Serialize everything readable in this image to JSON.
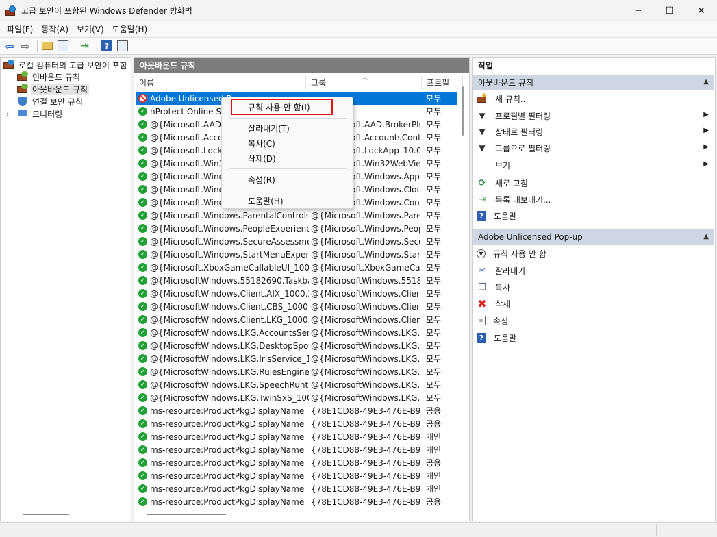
{
  "window": {
    "title": "고급 보안이 포함된 Windows Defender 방화벽",
    "minimize": "─",
    "maximize": "☐",
    "close": "✕"
  },
  "menubar": [
    "파일(F)",
    "동작(A)",
    "보기(V)",
    "도움말(H)"
  ],
  "toolbar": {
    "back_icon": "back-arrow-icon",
    "forward_icon": "forward-arrow-icon",
    "up_icon": "folder-up-icon",
    "show_hide_icon": "show-hide-tree-icon",
    "export_icon": "export-icon",
    "help_icon": "help-icon",
    "show_action_icon": "show-action-pane-icon"
  },
  "tree": {
    "root": "로컬 컴퓨터의 고급 보안이 포함",
    "items": [
      {
        "label": "인바운드 규칙",
        "icon": "inbound-rules-icon"
      },
      {
        "label": "아웃바운드 규칙",
        "icon": "outbound-rules-icon",
        "selected": true
      },
      {
        "label": "연결 보안 규칙",
        "icon": "connection-security-icon"
      },
      {
        "label": "모니터링",
        "icon": "monitoring-icon"
      }
    ]
  },
  "middle": {
    "header": "아웃바운드 규칙",
    "columns": [
      "이름",
      "그룹",
      "프로필"
    ],
    "rows": [
      {
        "name": "Adobe Unlicensed Pop-up",
        "group": "",
        "profile": "모두",
        "status": "blocked",
        "selected": true
      },
      {
        "name": "nProtect Online Security",
        "group": "",
        "profile": "모두",
        "status": "allow"
      },
      {
        "name": "@{Microsoft.AAD.BrokerPlugin",
        "group": "@{Microsoft.AAD.BrokerPlu...",
        "profile": "모두",
        "status": "allow"
      },
      {
        "name": "@{Microsoft.AccountsControl",
        "group": "@{Microsoft.AccountsCont...",
        "profile": "모두",
        "status": "allow"
      },
      {
        "name": "@{Microsoft.LockApp_10.0",
        "group": "@{Microsoft.LockApp_10.0....",
        "profile": "모두",
        "status": "allow"
      },
      {
        "name": "@{Microsoft.Win32WebViewHost",
        "group": "@{Microsoft.Win32WebVie...",
        "profile": "모두",
        "status": "allow"
      },
      {
        "name": "@{Microsoft.Windows.AppRep",
        "group": "@{Microsoft.Windows.Appr...",
        "profile": "모두",
        "status": "allow"
      },
      {
        "name": "@{Microsoft.Windows.CloudExperience",
        "group": "@{Microsoft.Windows.Clou...",
        "profile": "모두",
        "status": "allow"
      },
      {
        "name": "@{Microsoft.Windows.ContentDelivery",
        "group": "@{Microsoft.Windows.Cont...",
        "profile": "모두",
        "status": "allow"
      },
      {
        "name": "@{Microsoft.Windows.ParentalControls_...",
        "group": "@{Microsoft.Windows.Pare...",
        "profile": "모두",
        "status": "allow"
      },
      {
        "name": "@{Microsoft.Windows.PeopleExperience...",
        "group": "@{Microsoft.Windows.Peop...",
        "profile": "모두",
        "status": "allow"
      },
      {
        "name": "@{Microsoft.Windows.SecureAssessmen...",
        "group": "@{Microsoft.Windows.Secu...",
        "profile": "모두",
        "status": "allow"
      },
      {
        "name": "@{Microsoft.Windows.StartMenuExperie...",
        "group": "@{Microsoft.Windows.Start...",
        "profile": "모두",
        "status": "allow"
      },
      {
        "name": "@{Microsoft.XboxGameCallableUI_1000....",
        "group": "@{Microsoft.XboxGameCall...",
        "profile": "모두",
        "status": "allow"
      },
      {
        "name": "@{MicrosoftWindows.55182690.Taskba...",
        "group": "@{MicrosoftWindows.5518...",
        "profile": "모두",
        "status": "allow"
      },
      {
        "name": "@{MicrosoftWindows.Client.AIX_1000.2...",
        "group": "@{MicrosoftWindows.Clien...",
        "profile": "모두",
        "status": "allow"
      },
      {
        "name": "@{MicrosoftWindows.Client.CBS_1000....",
        "group": "@{MicrosoftWindows.Clien...",
        "profile": "모두",
        "status": "allow"
      },
      {
        "name": "@{MicrosoftWindows.Client.LKG_1000.2...",
        "group": "@{MicrosoftWindows.Clien...",
        "profile": "모두",
        "status": "allow"
      },
      {
        "name": "@{MicrosoftWindows.LKG.AccountsServ...",
        "group": "@{MicrosoftWindows.LKG....",
        "profile": "모두",
        "status": "allow"
      },
      {
        "name": "@{MicrosoftWindows.LKG.DesktopSpotl...",
        "group": "@{MicrosoftWindows.LKG....",
        "profile": "모두",
        "status": "allow"
      },
      {
        "name": "@{MicrosoftWindows.LKG.IrisService_10...",
        "group": "@{MicrosoftWindows.LKG.I...",
        "profile": "모두",
        "status": "allow"
      },
      {
        "name": "@{MicrosoftWindows.LKG.RulesEngine_...",
        "group": "@{MicrosoftWindows.LKG....",
        "profile": "모두",
        "status": "allow"
      },
      {
        "name": "@{MicrosoftWindows.LKG.SpeechRunti...",
        "group": "@{MicrosoftWindows.LKG....",
        "profile": "모두",
        "status": "allow"
      },
      {
        "name": "@{MicrosoftWindows.LKG.TwinSxS_100...",
        "group": "@{MicrosoftWindows.LKG.T...",
        "profile": "모두",
        "status": "allow"
      },
      {
        "name": "ms-resource:ProductPkgDisplayName",
        "group": "{78E1CD88-49E3-476E-B9...",
        "profile": "공용",
        "status": "allow"
      },
      {
        "name": "ms-resource:ProductPkgDisplayName",
        "group": "{78E1CD88-49E3-476E-B9...",
        "profile": "공용",
        "status": "allow"
      },
      {
        "name": "ms-resource:ProductPkgDisplayName",
        "group": "{78E1CD88-49E3-476E-B9...",
        "profile": "개인",
        "status": "allow"
      },
      {
        "name": "ms-resource:ProductPkgDisplayName",
        "group": "{78E1CD88-49E3-476E-B9...",
        "profile": "개인",
        "status": "allow"
      },
      {
        "name": "ms-resource:ProductPkgDisplayName",
        "group": "{78E1CD88-49E3-476E-B9...",
        "profile": "공용",
        "status": "allow"
      },
      {
        "name": "ms-resource:ProductPkgDisplayName",
        "group": "{78E1CD88-49E3-476E-B9...",
        "profile": "개인",
        "status": "allow"
      },
      {
        "name": "ms-resource:ProductPkgDisplayName",
        "group": "{78E1CD88-49E3-476E-B9...",
        "profile": "개인",
        "status": "allow"
      },
      {
        "name": "ms-resource:ProductPkgDisplayName",
        "group": "{78E1CD88-49E3-476E-B9...",
        "profile": "공용",
        "status": "allow"
      }
    ]
  },
  "context_menu": {
    "items": [
      {
        "label": "규칙 사용 안 함(I)",
        "highlighted": true
      },
      {
        "label": "잘라내기(T)"
      },
      {
        "label": "복사(C)"
      },
      {
        "label": "삭제(D)"
      },
      {
        "label": "속성(R)"
      },
      {
        "label": "도움말(H)"
      }
    ]
  },
  "actions": {
    "title": "작업",
    "section1": {
      "label": "아웃바운드 규칙",
      "items": [
        {
          "label": "새 규칙...",
          "icon": "new-rule-icon"
        },
        {
          "label": "프로필별 필터링",
          "icon": "filter-icon",
          "submenu": true
        },
        {
          "label": "상태로 필터링",
          "icon": "filter-icon",
          "submenu": true
        },
        {
          "label": "그룹으로 필터링",
          "icon": "filter-icon",
          "submenu": true
        },
        {
          "label": "보기",
          "icon": "",
          "submenu": true
        },
        {
          "label": "새로 고침",
          "icon": "refresh-icon"
        },
        {
          "label": "목록 내보내기...",
          "icon": "export-list-icon"
        },
        {
          "label": "도움말",
          "icon": "help-icon"
        }
      ]
    },
    "section2": {
      "label": "Adobe Unlicensed Pop-up",
      "items": [
        {
          "label": "규칙 사용 안 함",
          "icon": "disable-rule-icon"
        },
        {
          "label": "잘라내기",
          "icon": "cut-icon"
        },
        {
          "label": "복사",
          "icon": "copy-icon"
        },
        {
          "label": "삭제",
          "icon": "delete-icon"
        },
        {
          "label": "속성",
          "icon": "properties-icon"
        },
        {
          "label": "도움말",
          "icon": "help-icon"
        }
      ]
    }
  }
}
